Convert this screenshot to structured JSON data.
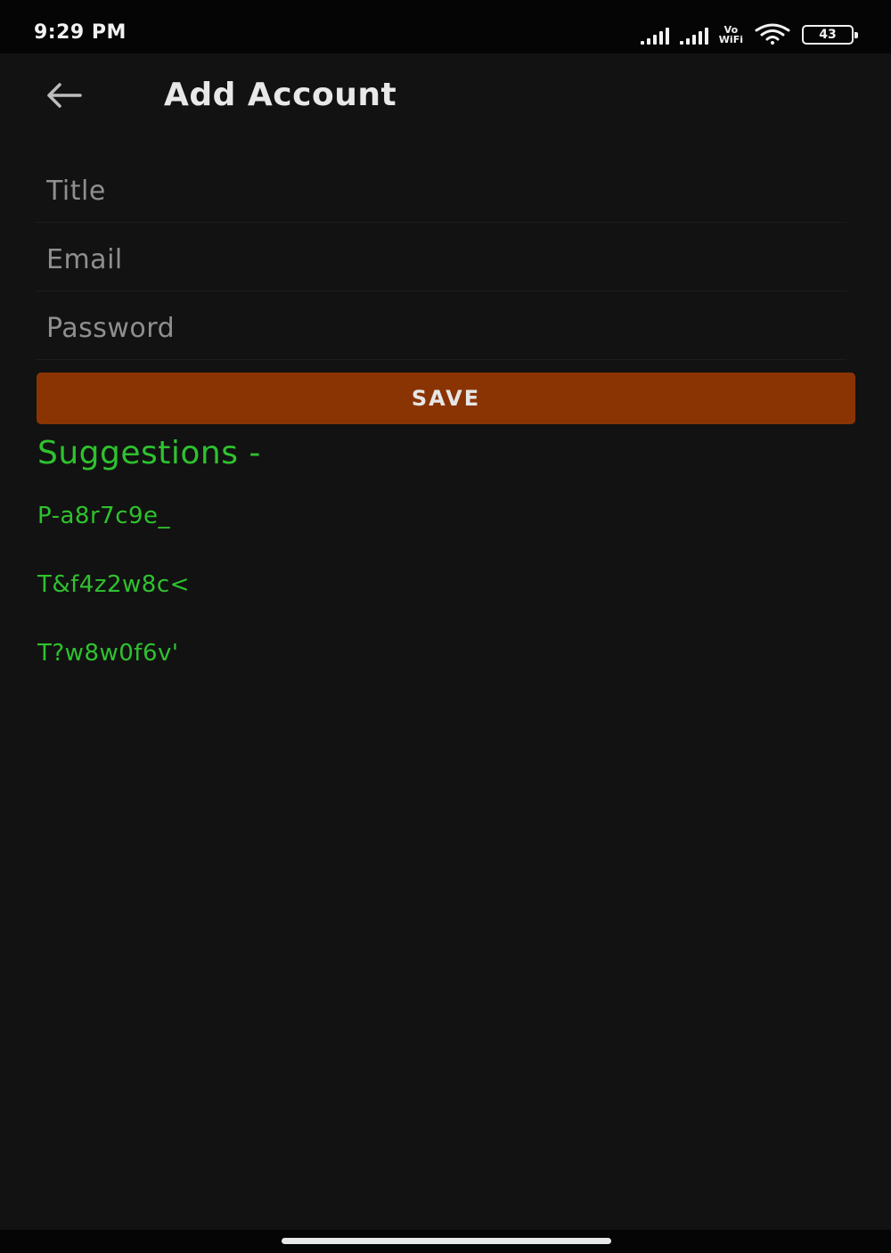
{
  "status_bar": {
    "time": "9:29 PM",
    "network_label_top": "Vo",
    "network_label_bottom": "WiFi",
    "battery_level": "43",
    "icons": [
      "signal-icon",
      "signal-icon",
      "vowifi-icon",
      "wifi-icon",
      "battery-icon"
    ]
  },
  "app_bar": {
    "title": "Add Account",
    "back_icon": "arrow-left-icon"
  },
  "form": {
    "title_placeholder": "Title",
    "email_placeholder": "Email",
    "password_placeholder": "Password",
    "title_value": "",
    "email_value": "",
    "password_value": ""
  },
  "save_label": "SAVE",
  "suggestions": {
    "heading": "Suggestions -",
    "items": [
      "P-a8r7c9e_",
      "T&f4z2w8c<",
      "T?w8w0f6v'"
    ]
  },
  "colors": {
    "background": "#121212",
    "accent_button": "#8a3404",
    "suggestion_text": "#2ec22e"
  }
}
